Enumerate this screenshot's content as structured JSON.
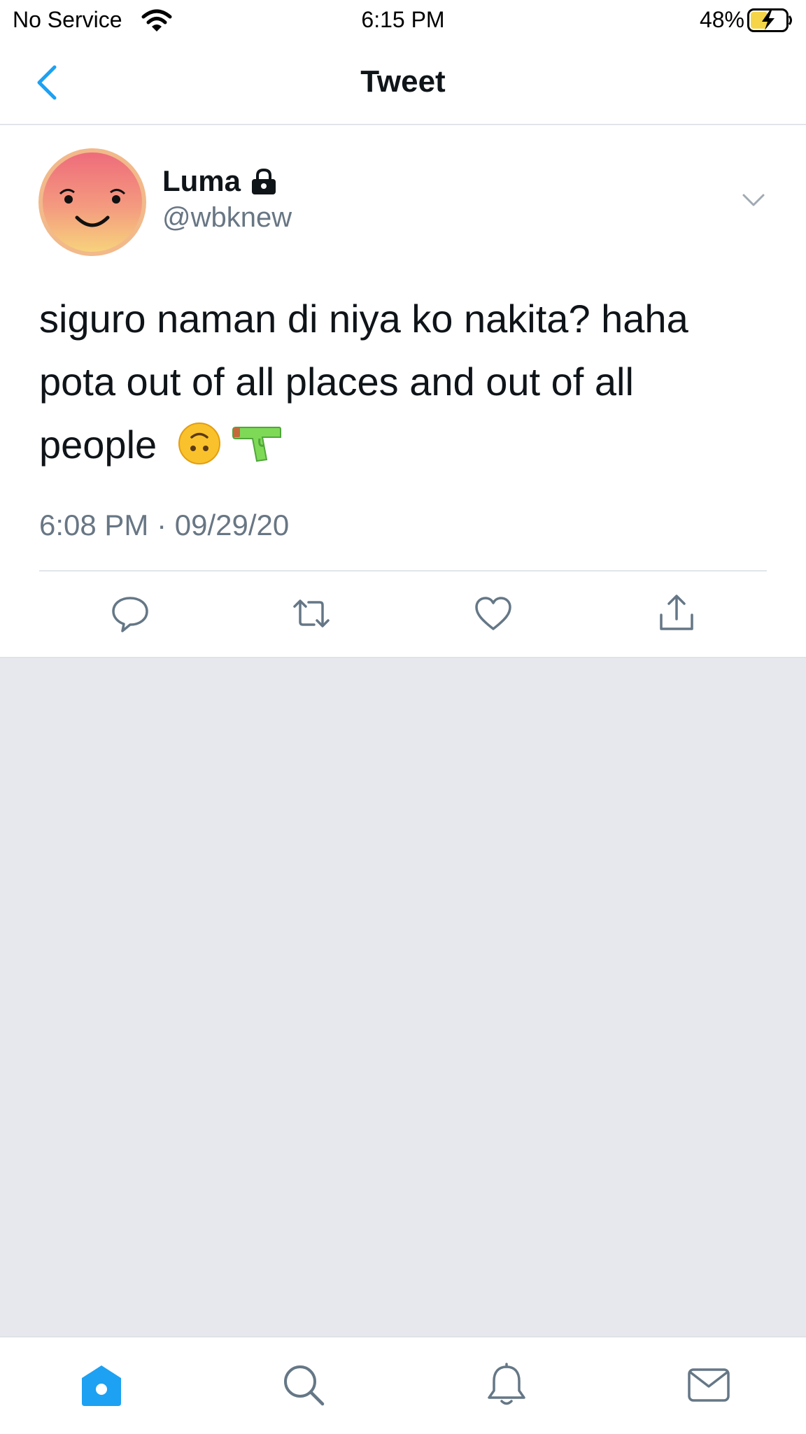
{
  "status_bar": {
    "carrier": "No Service",
    "time": "6:15 PM",
    "battery_percent": "48%",
    "battery_level": 0.48,
    "charging": true,
    "icons": [
      "wifi-icon",
      "battery-charging-icon"
    ]
  },
  "nav": {
    "title": "Tweet",
    "back_icon": "chevron-left-icon"
  },
  "tweet": {
    "author": {
      "display_name": "Luma",
      "handle": "@wbknew",
      "protected": true,
      "avatar": "smiling-face-avatar"
    },
    "text_lines": [
      "siguro naman di niya ko nakita? haha",
      "pota out of all places and out of all",
      "people"
    ],
    "emojis": [
      "upside-down-face-emoji",
      "water-pistol-emoji"
    ],
    "timestamp": "6:08 PM · 09/29/20",
    "actions": [
      "reply-icon",
      "retweet-icon",
      "like-icon",
      "share-icon"
    ]
  },
  "tab_bar": {
    "items": [
      "home-icon",
      "search-icon",
      "notifications-icon",
      "messages-icon"
    ],
    "active": "home-icon"
  },
  "colors": {
    "accent": "#1da1f2",
    "text": "#0f1419",
    "secondary_text": "#687684",
    "background": "#e6e8ed",
    "battery_fill": "#f5d547"
  }
}
